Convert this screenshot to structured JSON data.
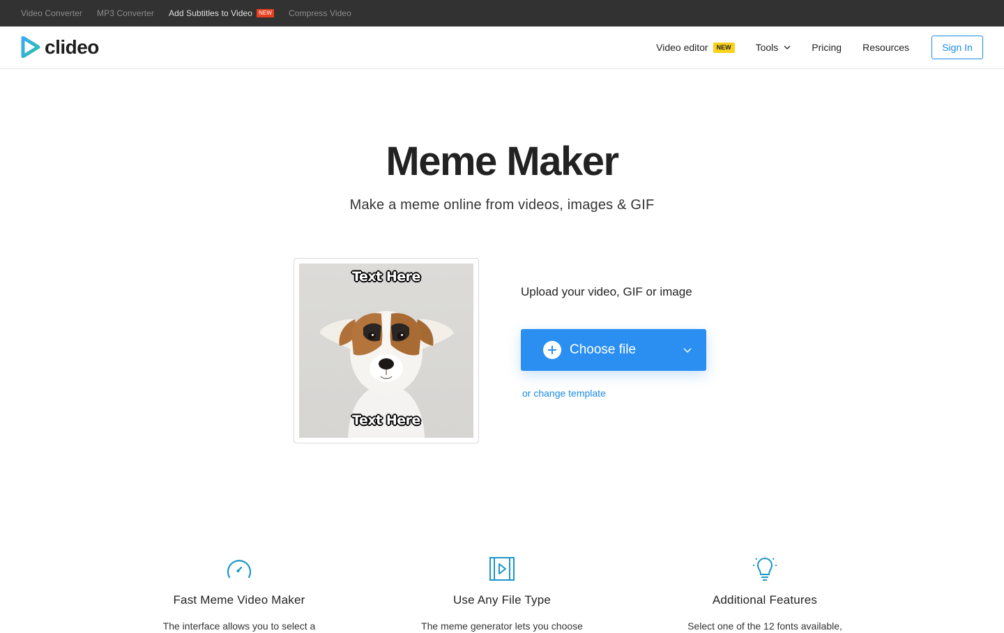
{
  "topbar": {
    "links": [
      {
        "label": "Video Converter"
      },
      {
        "label": "MP3 Converter"
      },
      {
        "label": "Add Subtitles to Video",
        "badge": "NEW"
      },
      {
        "label": "Compress Video"
      }
    ]
  },
  "header": {
    "logo_text": "clideo",
    "nav": {
      "video_editor": "Video editor",
      "video_editor_badge": "NEW",
      "tools": "Tools",
      "pricing": "Pricing",
      "resources": "Resources",
      "sign_in": "Sign In"
    }
  },
  "hero": {
    "title": "Meme Maker",
    "subtitle": "Make a meme online from videos, images & GIF"
  },
  "template": {
    "top_text": "Text Here",
    "bottom_text": "Text Here"
  },
  "upload": {
    "label": "Upload your video, GIF or image",
    "choose_file": "Choose file",
    "change_template": "or change template"
  },
  "features": [
    {
      "title": "Fast Meme Video Maker",
      "text": "The interface allows you to select a",
      "icon": "speedometer-icon"
    },
    {
      "title": "Use Any File Type",
      "text": "The meme generator lets you choose",
      "icon": "video-file-icon"
    },
    {
      "title": "Additional Features",
      "text": "Select one of the 12 fonts available,",
      "icon": "lightbulb-icon"
    }
  ],
  "colors": {
    "accent": "#2a8ff0",
    "logo_teal": "#2cc0a8",
    "topbar_bg": "#323232",
    "badge_red": "#e8401f",
    "badge_yellow": "#f8d21c"
  }
}
